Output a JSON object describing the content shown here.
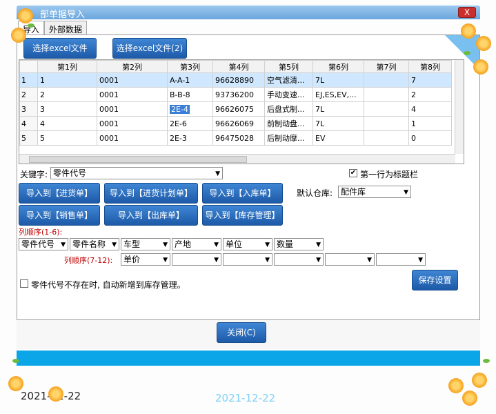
{
  "window": {
    "title": "部单据导入",
    "close_label": "X"
  },
  "tabs": [
    {
      "label": "导入"
    },
    {
      "label": "外部数据"
    }
  ],
  "buttons": {
    "select_excel": "选择excel文件",
    "select_excel_2": "选择excel文件(2)",
    "import_purchase": "导入到【进货单】",
    "import_purchase_plan": "导入到【进货计划单】",
    "import_inbound": "导入到【入库单】",
    "import_sales": "导入到【销售单】",
    "import_outbound": "导入到【出库单】",
    "import_inventory": "导入到【库存管理】",
    "save_settings": "保存设置",
    "close": "关闭(C)"
  },
  "grid": {
    "columns": [
      "第1列",
      "第2列",
      "第3列",
      "第4列",
      "第5列",
      "第6列",
      "第7列",
      "第8列"
    ],
    "rows": [
      {
        "n": "1",
        "cells": [
          "1",
          "0001",
          "A-A-1",
          "96628890",
          "空气滤清...",
          "7L",
          "",
          "7"
        ]
      },
      {
        "n": "2",
        "cells": [
          "2",
          "0001",
          "B-B-8",
          "93736200",
          "手动变速...",
          "EJ,ES,EV,...",
          "",
          "2"
        ]
      },
      {
        "n": "3",
        "cells": [
          "3",
          "0001",
          "2E-4",
          "96626075",
          "后盘式制...",
          "7L",
          "",
          "4"
        ]
      },
      {
        "n": "4",
        "cells": [
          "4",
          "0001",
          "2E-6",
          "96626069",
          "前制动盘...",
          "7L",
          "",
          "1"
        ]
      },
      {
        "n": "5",
        "cells": [
          "5",
          "0001",
          "2E-3",
          "96475028",
          "后制动摩...",
          "EV",
          "",
          "0"
        ]
      }
    ]
  },
  "keyword": {
    "label": "关键字:",
    "value": "零件代号"
  },
  "first_row_title": {
    "label": "第一行为标题栏",
    "checked": true
  },
  "default_warehouse": {
    "label": "默认仓库:",
    "value": "配件库"
  },
  "order1": {
    "label": "列顺序(1-6):",
    "values": [
      "零件代号",
      "零件名称",
      "车型",
      "产地",
      "单位",
      "数量"
    ]
  },
  "order2": {
    "label": "列顺序(7-12):",
    "values": [
      "单价",
      "",
      "",
      "",
      "",
      ""
    ]
  },
  "auto_add": {
    "label": "零件代号不存在时, 自动新增到库存管理。",
    "checked": false
  },
  "dates": {
    "dark": "2021-12-22",
    "light": "2021-12-22"
  },
  "colors": {
    "accent": "#1d5aa8",
    "band": "#0aa6e8",
    "selected_row": "#cfe8ff"
  }
}
